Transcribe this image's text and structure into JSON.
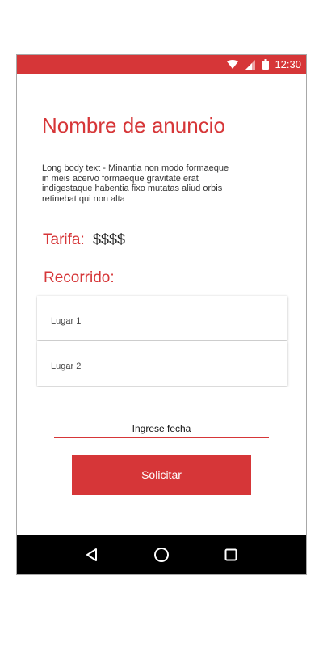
{
  "status_bar": {
    "time": "12:30",
    "icons": [
      "wifi-icon",
      "signal-icon",
      "battery-icon"
    ]
  },
  "ad": {
    "title": "Nombre de anuncio",
    "body": "Long body text - Minantia non modo formaeque in meis acervo formaeque gravitate erat indigestaque habentia fixo mutatas aliud orbis retinebat qui non alta"
  },
  "fare": {
    "label": "Tarifa:",
    "value": "$$$$"
  },
  "route": {
    "label": "Recorrido:",
    "places": [
      "Lugar 1",
      "Lugar 2"
    ]
  },
  "date_field": {
    "label": "Ingrese fecha"
  },
  "request_button": {
    "label": "Solicitar"
  },
  "nav_bar": {
    "buttons": [
      "back-icon",
      "home-icon",
      "recents-icon"
    ]
  },
  "colors": {
    "accent": "#d63638",
    "nav_bar": "#000000"
  }
}
